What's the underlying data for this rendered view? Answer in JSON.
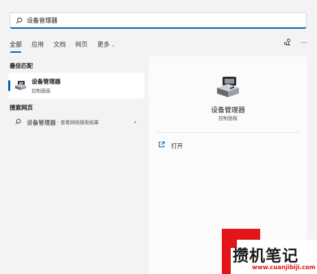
{
  "search": {
    "value": "设备管理器",
    "icon": "search-icon"
  },
  "tabs": [
    {
      "label": "全部",
      "active": true
    },
    {
      "label": "应用"
    },
    {
      "label": "文档"
    },
    {
      "label": "网页"
    },
    {
      "label": "更多"
    }
  ],
  "top_actions": {
    "share_icon": "share-icon",
    "more_icon": "more-icon",
    "more_label": "···"
  },
  "best_match": {
    "header": "最佳匹配",
    "title": "设备管理器",
    "subtitle": "控制面板",
    "icon": "device-manager-icon"
  },
  "web_search": {
    "header": "搜索网页",
    "query": "设备管理器",
    "hint": " - 查看网络搜索结果",
    "arrow": "›"
  },
  "detail": {
    "title": "设备管理器",
    "category": "控制面板",
    "actions": [
      {
        "label": "打开",
        "icon": "open-icon"
      }
    ]
  },
  "watermark": {
    "title": "攒机笔记",
    "url": "www.cuanjibiji.com"
  },
  "colors": {
    "accent": "#005fb8",
    "watermark_red": "#e21618",
    "background": "#f3f3f3"
  }
}
